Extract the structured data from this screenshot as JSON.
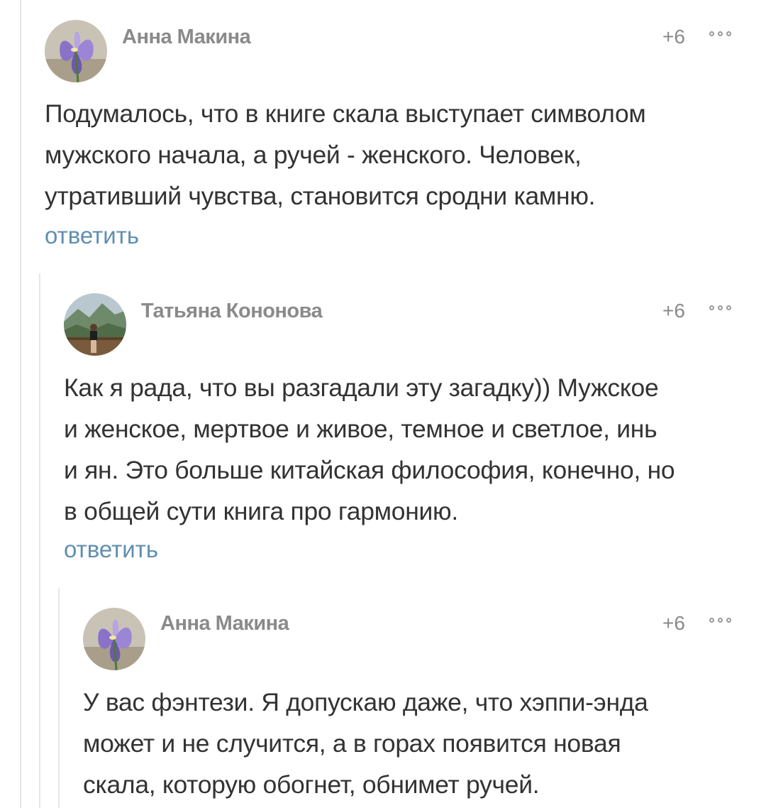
{
  "comments": [
    {
      "author": "Анна Макина",
      "rating": "+6",
      "text": "Подумалось, что в книге скала выступает символом\nмужского начала, а ручей - женского. Человек,\nутративший чувства, становится сродни камню.",
      "reply_label": "ответить",
      "avatar_icon": "iris-flower-avatar"
    },
    {
      "author": "Татьяна Кононова",
      "rating": "+6",
      "text": "Как я рада, что вы разгадали эту загадку)) Мужское\nи женское, мертвое и живое, темное и светлое, инь\nи ян. Это больше китайская философия, конечно, но\nв общей сути книга про гармонию.",
      "reply_label": "ответить",
      "avatar_icon": "person-mountains-avatar"
    },
    {
      "author": "Анна Макина",
      "rating": "+6",
      "text": "У вас фэнтези. Я допускаю даже, что хэппи-энда\nможет и не случится, а в горах появится новая\nскала, которую обогнет, обнимет ручей.",
      "avatar_icon": "iris-flower-avatar"
    }
  ],
  "colors": {
    "author": "#8a8a8a",
    "text": "#333333",
    "link": "#5f8fb0",
    "thread_line": "#e6e6e6"
  },
  "icons": {
    "more": "more-options-icon"
  }
}
